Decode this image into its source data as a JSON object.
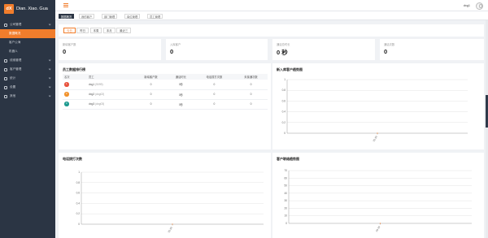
{
  "logo": {
    "mark": "dX",
    "text": "Dian. Xiao. Gua"
  },
  "sidebar": {
    "groups": [
      {
        "label": "公司管理",
        "icon": "monitor-icon",
        "items": [
          {
            "label": "数据概况",
            "active": true
          },
          {
            "label": "客户公海",
            "active": false
          },
          {
            "label": "机器人",
            "active": false
          }
        ]
      },
      {
        "label": "线索管理",
        "icon": "clue-icon",
        "items": []
      },
      {
        "label": "客户管理",
        "icon": "user-icon",
        "items": []
      },
      {
        "label": "统计",
        "icon": "chart-icon",
        "items": []
      },
      {
        "label": "设置",
        "icon": "gear-icon",
        "items": []
      },
      {
        "label": "其他",
        "icon": "more-icon",
        "items": []
      }
    ]
  },
  "header": {
    "username": "dxg1"
  },
  "tabs": [
    "数据概况",
    "我的客户",
    "部门管理",
    "岗位管理",
    "员工管理"
  ],
  "range_buttons": [
    "今日",
    "昨日",
    "本周",
    "本月",
    "最近三"
  ],
  "stats": [
    {
      "label": "新增客户数",
      "value": "0"
    },
    {
      "label": "入库客户",
      "value": "0"
    },
    {
      "label": "通话总时长",
      "value": "0 秒"
    },
    {
      "label": "通话次数",
      "value": "0"
    }
  ],
  "ranking": {
    "title": "员工数据排行榜",
    "columns": [
      "名次",
      "员工",
      "新增客户数",
      "通话时长",
      "电话拨打次数",
      "未接通次数"
    ],
    "rows": [
      {
        "rank": "1",
        "color": "#e8533e",
        "name": "dxg1",
        "account": "(9099)",
        "new_customers": "0",
        "duration": "0秒",
        "calls": "0",
        "missed": "0"
      },
      {
        "rank": "2",
        "color": "#f1922c",
        "name": "dxg2",
        "account": "(dxg02)",
        "new_customers": "0",
        "duration": "0秒",
        "calls": "0",
        "missed": "0"
      },
      {
        "rank": "3",
        "color": "#1d9a8f",
        "name": "dxg3",
        "account": "(dxg03)",
        "new_customers": "0",
        "duration": "0秒",
        "calls": "0",
        "missed": "0"
      }
    ]
  },
  "charts_titles": {
    "customer_trend": "新入库客户趋势图",
    "call_trend": "电话拨打次数",
    "follow_trend": "客户联络趋势图"
  },
  "chart_data": [
    {
      "type": "line",
      "title": "新入库客户趋势图",
      "x": [
        "03-30"
      ],
      "series": [
        {
          "values": [
            0
          ]
        }
      ],
      "ylim": [
        0,
        1
      ],
      "yticks": [
        "0",
        "0.2",
        "0.4",
        "0.6",
        "0.8",
        "1"
      ],
      "grid": true
    },
    {
      "type": "line",
      "title": "电话拨打次数",
      "x": [
        "03-30"
      ],
      "series": [
        {
          "values": [
            0
          ]
        }
      ],
      "ylim": [
        0,
        1
      ],
      "yticks": [
        "0",
        "0.2",
        "0.4",
        "0.6",
        "0.8",
        "1"
      ],
      "grid": true
    },
    {
      "type": "line",
      "title": "客户联络趋势图",
      "x": [
        "03-30"
      ],
      "series": [
        {
          "values": [
            0
          ]
        }
      ],
      "ylim": [
        0,
        70
      ],
      "yticks": [
        "0",
        "10",
        "20",
        "30",
        "40",
        "50",
        "60",
        "70"
      ],
      "grid": true
    }
  ],
  "colors": {
    "accent": "#f17d2c",
    "sidebar": "#2b3544"
  }
}
